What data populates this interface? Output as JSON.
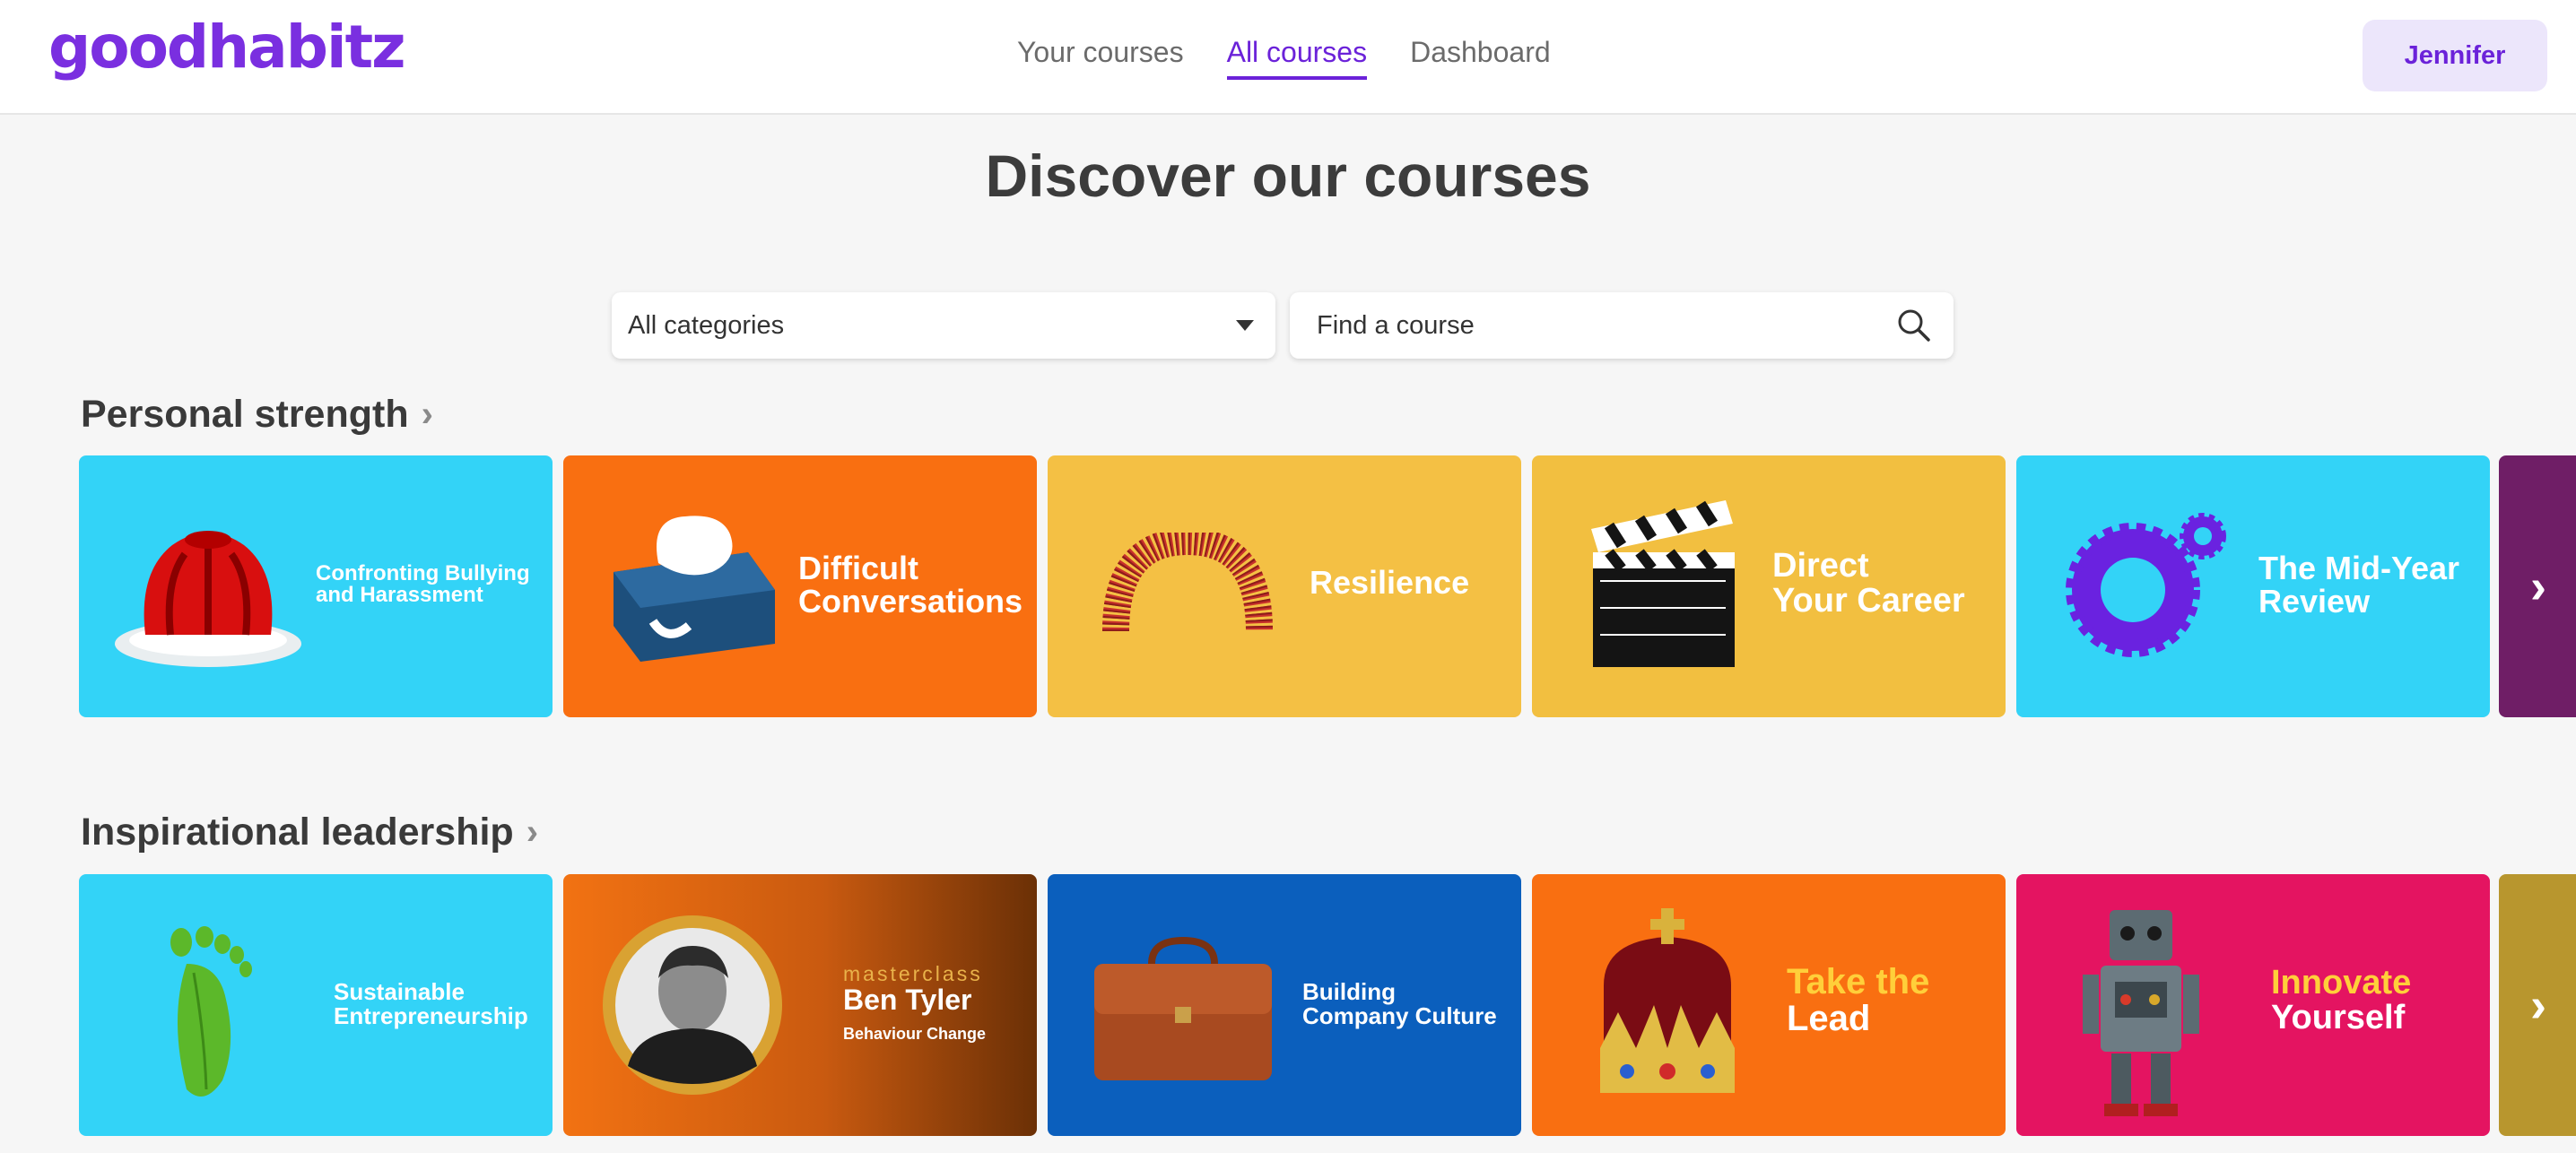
{
  "header": {
    "logo": "goodhabitz",
    "nav": [
      "Your courses",
      "All courses",
      "Dashboard"
    ],
    "active_nav": "All courses",
    "user_button": "Jennifer"
  },
  "title": "Discover our courses",
  "filters": {
    "category": "All categories",
    "search_placeholder": "Find a course"
  },
  "sections": [
    {
      "title": "Personal strength",
      "cards": [
        {
          "lines": [
            "Confronting Bullying",
            "and Harassment"
          ],
          "color": "#33d3f7",
          "icon": "jelly-icon"
        },
        {
          "lines": [
            "Difficult",
            "Conversations"
          ],
          "color": "#f96f11",
          "icon": "tissue-box-icon"
        },
        {
          "lines": [
            "Resilience"
          ],
          "color": "#f4c044",
          "icon": "spring-icon"
        },
        {
          "lines": [
            "Direct",
            "Your Career"
          ],
          "color": "#f2bf40",
          "icon": "clapperboard-icon"
        },
        {
          "lines": [
            "The Mid-Year",
            "Review"
          ],
          "color": "#33d3f7",
          "icon": "gears-icon"
        }
      ],
      "peek_color": "#6f1e66"
    },
    {
      "title": "Inspirational leadership",
      "cards": [
        {
          "lines": [
            "Sustainable",
            "Entrepreneurship"
          ],
          "color": "#33d3f7",
          "icon": "leaf-footprint-icon"
        },
        {
          "masterclass": "masterclass",
          "name": "Ben Tyler",
          "subtitle": "Behaviour Change",
          "color": "#f06f12",
          "icon": "avatar"
        },
        {
          "lines": [
            "Building",
            "Company Culture"
          ],
          "color": "#0b5fbd",
          "icon": "briefcase-icon"
        },
        {
          "lines": [
            "Take the",
            "Lead"
          ],
          "accent_line": 0,
          "accent": "#ffcf3a",
          "color": "#f96f11",
          "icon": "crown-icon"
        },
        {
          "lines": [
            "Innovate",
            "Yourself"
          ],
          "accent_line": 0,
          "accent": "#ffcf3a",
          "color": "#e41461",
          "icon": "robot-icon"
        }
      ],
      "peek_color": "#b8962e"
    }
  ],
  "colors": {
    "brand": "#6b22d9",
    "logo": "#7a2fe0"
  }
}
